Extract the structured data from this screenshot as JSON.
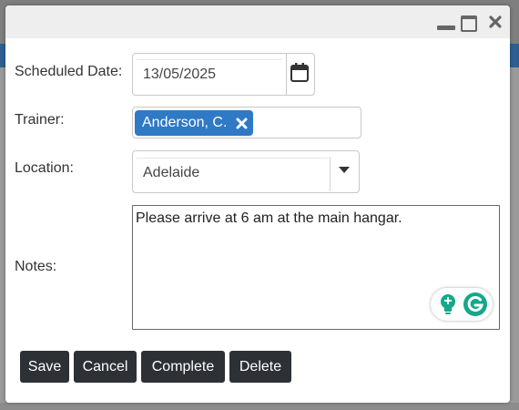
{
  "dialog": {
    "window_controls": {
      "minimize_icon": "minimize-icon",
      "maximize_icon": "maximize-icon",
      "close_icon": "close-icon"
    },
    "fields": {
      "scheduled_date": {
        "label": "Scheduled Date:",
        "value": "13/05/2025",
        "icon": "calendar-icon"
      },
      "trainer": {
        "label": "Trainer:",
        "chips": [
          "Anderson, C."
        ],
        "chip_remove_icon": "remove-x-icon"
      },
      "location": {
        "label": "Location:",
        "value": "Adelaide",
        "icon": "caret-down-icon"
      },
      "notes": {
        "label": "Notes:",
        "value": "Please arrive at 6 am at the main hangar."
      }
    },
    "buttons": {
      "save": "Save",
      "cancel": "Cancel",
      "complete": "Complete",
      "delete": "Delete"
    },
    "colors": {
      "chip": "#2f79c5",
      "button": "#2d3136",
      "grammarly": "#15a88a",
      "titlebar": "#eeeeee"
    }
  }
}
